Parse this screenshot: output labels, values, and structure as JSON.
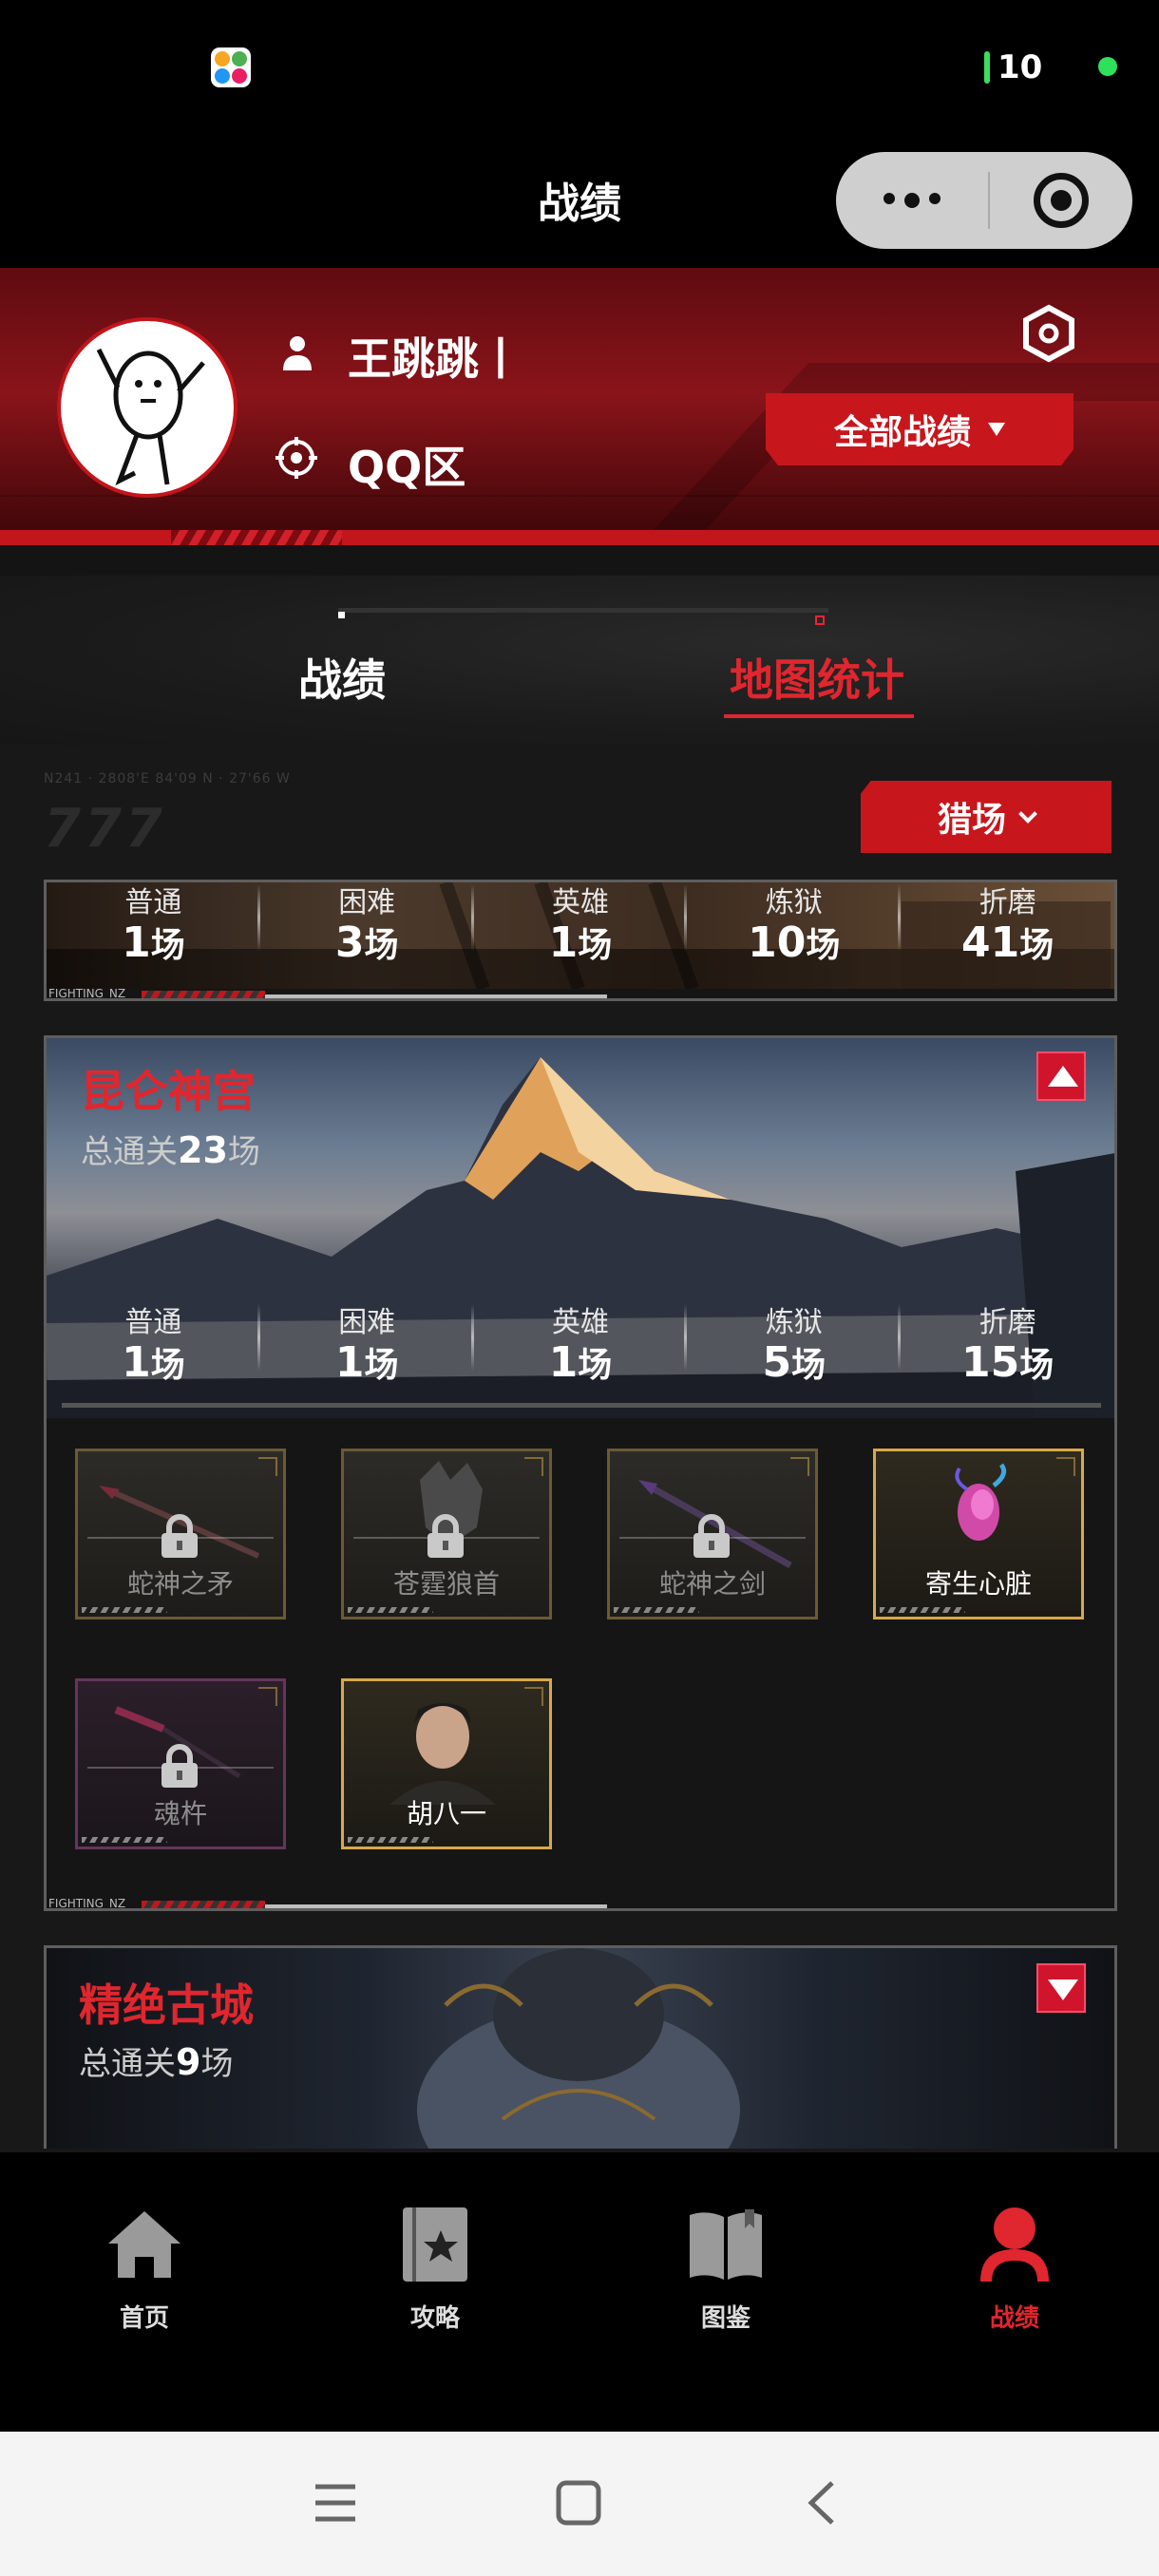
{
  "status_bar": {
    "battery": "10"
  },
  "nav": {
    "title": "战绩"
  },
  "profile": {
    "name": "王跳跳丨",
    "zone": "QQ区",
    "all_records_button": "全部战绩"
  },
  "tabs": [
    {
      "label": "战绩",
      "active": false
    },
    {
      "label": "地图统计",
      "active": true
    }
  ],
  "deco": {
    "code": "N241 · 2808'E 84'09 N · 27'66 W",
    "number": "777"
  },
  "filter": {
    "mode_button": "猎场"
  },
  "difficulty_labels": [
    "普通",
    "困难",
    "英雄",
    "炼狱",
    "折磨"
  ],
  "unit": "场",
  "cards": [
    {
      "title": "",
      "counts": [
        "1",
        "3",
        "1",
        "10",
        "41"
      ],
      "footer": "FIGHTING_NZ"
    },
    {
      "title": "昆仑神宫",
      "clear_prefix": "总通关",
      "clear_count": "23",
      "clear_unit": "场",
      "expanded": true,
      "counts": [
        "1",
        "1",
        "1",
        "5",
        "15"
      ],
      "rewards": [
        {
          "name": "蛇神之矛",
          "locked": true
        },
        {
          "name": "苍霆狼首",
          "locked": true
        },
        {
          "name": "蛇神之剑",
          "locked": true
        },
        {
          "name": "寄生心脏",
          "locked": false
        },
        {
          "name": "魂杵",
          "locked": true
        },
        {
          "name": "胡八一",
          "locked": false
        }
      ],
      "footer": "FIGHTING_NZ"
    },
    {
      "title": "精绝古城",
      "clear_prefix": "总通关",
      "clear_count": "9",
      "clear_unit": "场",
      "expanded": false
    }
  ],
  "tabbar": [
    {
      "label": "首页",
      "icon": "home-icon",
      "active": false
    },
    {
      "label": "攻略",
      "icon": "guide-book-icon",
      "active": false
    },
    {
      "label": "图鉴",
      "icon": "open-book-icon",
      "active": false
    },
    {
      "label": "战绩",
      "icon": "user-icon",
      "active": true
    }
  ],
  "colors": {
    "accent": "#e0262e",
    "button_red": "#c8161d",
    "header_red": "#8a141a",
    "background": "#181818"
  }
}
